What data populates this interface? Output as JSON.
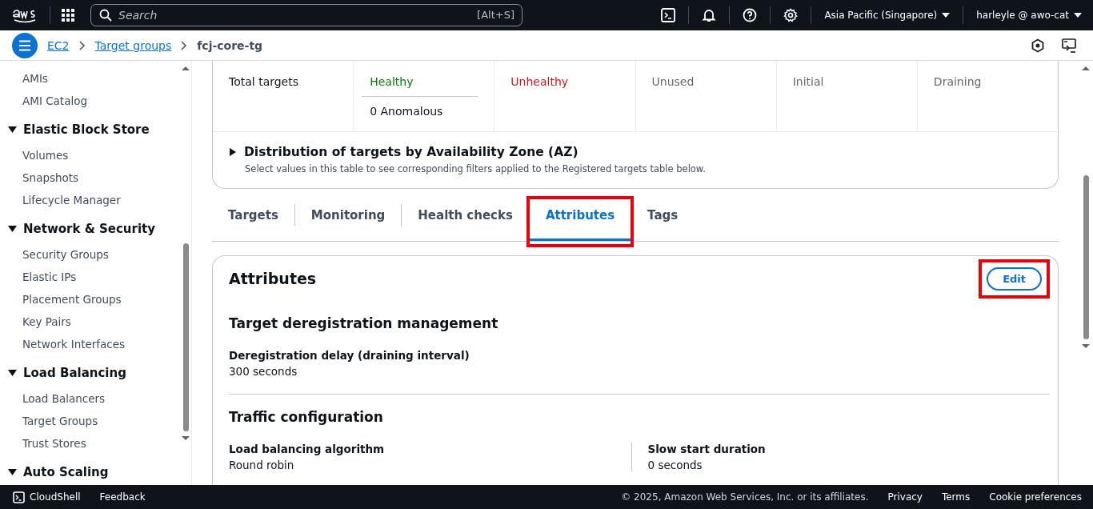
{
  "top_nav": {
    "search": {
      "placeholder": "Search",
      "shortcut": "[Alt+S]"
    },
    "region": "Asia Pacific (Singapore)",
    "account": "harleyle @ awo-cat"
  },
  "breadcrumbs": [
    {
      "label": "EC2",
      "link": true
    },
    {
      "label": "Target groups",
      "link": true
    },
    {
      "label": "fcj-core-tg",
      "link": false
    }
  ],
  "sidebar": {
    "sections": [
      {
        "items": [
          "AMIs",
          "AMI Catalog"
        ]
      },
      {
        "title": "Elastic Block Store",
        "expanded": true,
        "items": [
          "Volumes",
          "Snapshots",
          "Lifecycle Manager"
        ]
      },
      {
        "title": "Network & Security",
        "expanded": true,
        "items": [
          "Security Groups",
          "Elastic IPs",
          "Placement Groups",
          "Key Pairs",
          "Network Interfaces"
        ]
      },
      {
        "title": "Load Balancing",
        "expanded": true,
        "items": [
          "Load Balancers",
          "Target Groups",
          "Trust Stores"
        ]
      },
      {
        "title": "Auto Scaling",
        "expanded": true
      }
    ]
  },
  "stats": [
    {
      "label": "Total targets",
      "kind": "total"
    },
    {
      "label": "Healthy",
      "kind": "healthy",
      "sub": "0 Anomalous"
    },
    {
      "label": "Unhealthy",
      "kind": "unhealthy"
    },
    {
      "label": "Unused",
      "kind": "muted"
    },
    {
      "label": "Initial",
      "kind": "muted"
    },
    {
      "label": "Draining",
      "kind": "muted"
    }
  ],
  "distribution": {
    "title": "Distribution of targets by Availability Zone (AZ)",
    "expanded": false,
    "description": "Select values in this table to see corresponding filters applied to the Registered targets table below."
  },
  "tabs": [
    {
      "label": "Targets",
      "selected": false,
      "highlighted": false
    },
    {
      "label": "Monitoring",
      "selected": false,
      "highlighted": false
    },
    {
      "label": "Health checks",
      "selected": false,
      "highlighted": false
    },
    {
      "label": "Attributes",
      "selected": true,
      "highlighted": true
    },
    {
      "label": "Tags",
      "selected": false,
      "highlighted": false
    }
  ],
  "attributes": {
    "title": "Attributes",
    "edit_button": {
      "label": "Edit",
      "highlighted": true
    },
    "sections": [
      {
        "title": "Target deregistration management",
        "fields": [
          {
            "label": "Deregistration delay (draining interval)",
            "value": "300 seconds"
          }
        ]
      },
      {
        "title": "Traffic configuration",
        "fields": [
          {
            "label": "Load balancing algorithm",
            "value": "Round robin"
          },
          {
            "label": "Slow start duration",
            "value": "0 seconds"
          }
        ]
      }
    ]
  },
  "footer": {
    "left": [
      "CloudShell",
      "Feedback"
    ],
    "copyright": "© 2025, Amazon Web Services, Inc. or its affiliates.",
    "links": [
      "Privacy",
      "Terms",
      "Cookie preferences"
    ]
  }
}
